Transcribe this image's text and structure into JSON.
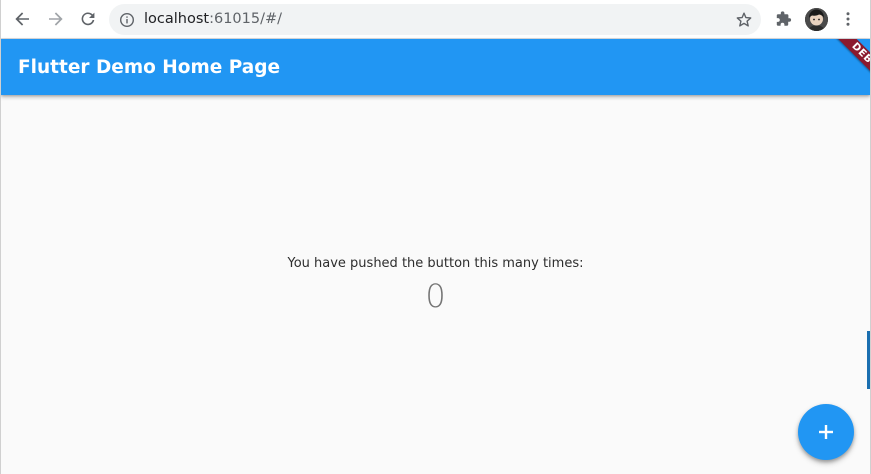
{
  "browser": {
    "url_host": "localhost",
    "url_rest": ":61015/#/"
  },
  "app": {
    "title": "Flutter Demo Home Page",
    "debug_banner": "DEBUG",
    "message": "You have pushed the button this many times:",
    "counter": "0",
    "fab_icon": "+"
  },
  "colors": {
    "primary": "#2196f3",
    "debug": "#8b1a2e",
    "background": "#fafafa"
  },
  "icons": {
    "back": "back-arrow-icon",
    "forward": "forward-arrow-icon",
    "reload": "reload-icon",
    "site_info": "info-icon",
    "bookmark": "star-icon",
    "extensions": "puzzle-icon",
    "profile": "avatar",
    "menu": "kebab-menu-icon",
    "fab": "add-icon"
  }
}
